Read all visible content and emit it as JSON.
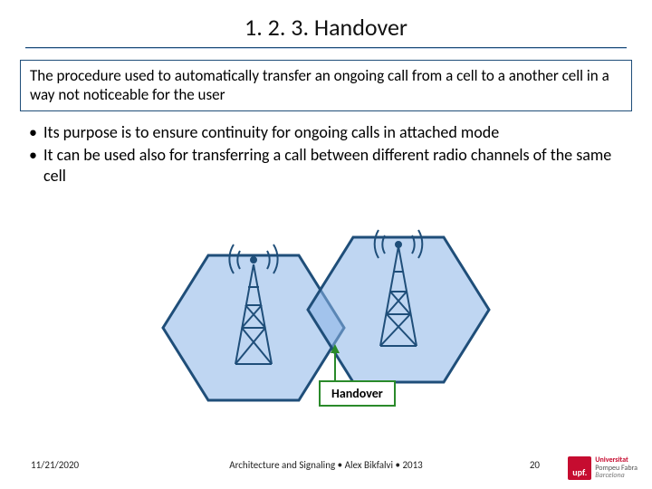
{
  "title": "1. 2. 3. Handover",
  "definition": "The procedure used to automatically transfer an ongoing call from a cell to a another cell in a way not noticeable for the user",
  "bullets": [
    "Its purpose is to ensure continuity for ongoing calls in attached mode",
    "It can be used also for transferring a call between different radio channels of the same cell"
  ],
  "diagram_label": "Handover",
  "footer": {
    "date": "11/21/2020",
    "center": "Architecture and Signaling • Alex Bikfalvi • 2013",
    "page": "20"
  },
  "logo": {
    "abbrev": "upf.",
    "line1": "Universitat",
    "line2": "Pompeu Fabra",
    "line3": "Barcelona"
  }
}
